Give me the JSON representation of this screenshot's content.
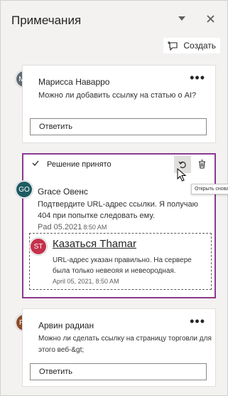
{
  "header": {
    "title": "Примечания",
    "create_label": "Создать"
  },
  "comments": [
    {
      "initials": "MN",
      "author": "Марисса Наварро",
      "text": "Можно ли добавить ссылку на статью о AI?",
      "reply_placeholder": "Ответить",
      "more": "•••",
      "avatar_color": "#5f6b74"
    },
    {
      "resolved_label": "Решение принято",
      "initials": "GO",
      "author": "Grace Овенс",
      "text": "Подтвердите URL-адрес ссылки. Я получаю 404 при попытке следовать ему.",
      "date": "Pad 05.2021",
      "time": "8:50 AM",
      "avatar_color": "#1e5b63",
      "accent": "#8b3a8f",
      "reply": {
        "initials": "ST",
        "author": "Казаться Thamar",
        "text": "URL-адрес указан правильно. На сервере была только невеояя и невеородная.",
        "date": "April 05, 2021, 8:50 AM",
        "avatar_color": "#c4314b"
      },
      "tooltip": "Открыть снова"
    },
    {
      "initials": "PR",
      "author": "Арвин радиан",
      "text": "Можно ли сделать ссылку на страницу торговли для этого веб-&gt;",
      "reply_placeholder": "Ответить",
      "more": "•••",
      "avatar_color": "#8a4b2c"
    }
  ],
  "icons": [
    "dropdown-icon",
    "close-icon",
    "new-comment-icon",
    "checkmark-icon",
    "reopen-icon",
    "delete-icon",
    "cursor-icon"
  ]
}
